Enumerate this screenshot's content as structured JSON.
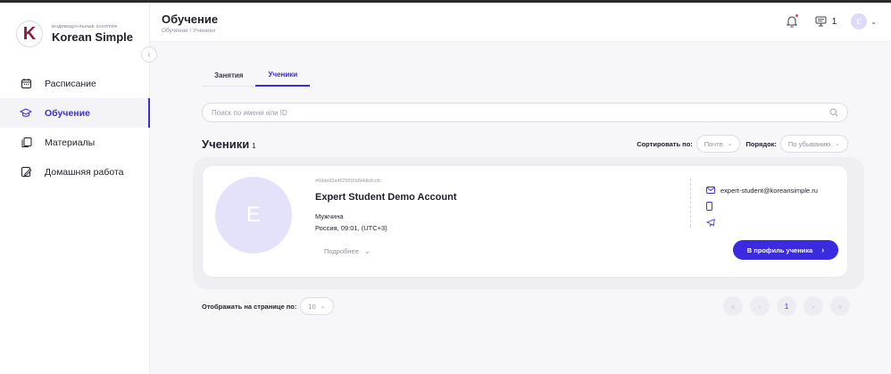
{
  "brand": {
    "subtitle": "ИНДИВИДУАЛЬНЫЕ ЗАНЯТИЯ",
    "name": "Korean Simple",
    "logo_letter": "K"
  },
  "sidebar": {
    "items": [
      {
        "label": "Расписание",
        "icon": "calendar-icon",
        "active": false
      },
      {
        "label": "Обучение",
        "icon": "graduation-cap-icon",
        "active": true
      },
      {
        "label": "Материалы",
        "icon": "materials-icon",
        "active": false
      },
      {
        "label": "Домашняя работа",
        "icon": "homework-icon",
        "active": false
      }
    ]
  },
  "header": {
    "title": "Обучение",
    "breadcrumb": "Обучение / Ученики",
    "tasks_count": "1",
    "avatar_letter": "E"
  },
  "tabs": [
    {
      "label": "Занятия",
      "active": false
    },
    {
      "label": "Ученики",
      "active": true
    }
  ],
  "search": {
    "placeholder": "Поиск по имени или ID",
    "value": ""
  },
  "list": {
    "title": "Ученики",
    "count": "1",
    "sort_label": "Сортировать по:",
    "sort_value": "Почте",
    "order_label": "Порядок:",
    "order_value": "По убыванию"
  },
  "student": {
    "avatar_letter": "E",
    "id": "#68de82a4529599d94db9ccfc",
    "name": "Expert Student Demo Account",
    "gender": "Мужчина",
    "location": "Россия, 09:01, (UTC+3)",
    "more_label": "Подробнее",
    "email": "expert-student@koreansimple.ru",
    "profile_button": "В профиль ученика"
  },
  "footer": {
    "per_page_label": "Отображать на странице по:",
    "per_page_value": "10",
    "current_page": "1"
  },
  "colors": {
    "accent": "#3a2be0",
    "avatar_bg": "#e4e1fb",
    "brand_logo": "#8c1f3c"
  }
}
